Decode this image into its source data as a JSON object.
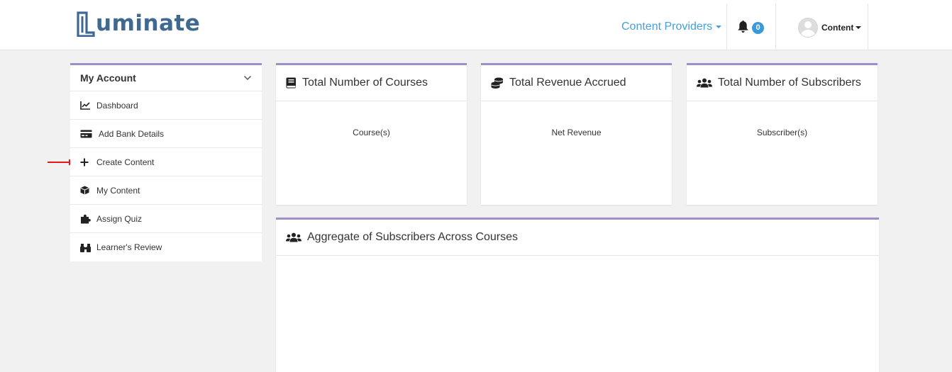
{
  "brand": {
    "logo_text": "uminate",
    "logo_color": "#3f6990"
  },
  "header": {
    "nav_label": "Content Providers",
    "notification_count": "0",
    "user_name": "Content",
    "accent_color": "#45a0e0"
  },
  "sidebar": {
    "title": "My Account",
    "items": [
      {
        "label": "Dashboard",
        "icon": "chart-line-icon"
      },
      {
        "label": "Add Bank Details",
        "icon": "credit-card-icon"
      },
      {
        "label": "Create Content",
        "icon": "plus-icon"
      },
      {
        "label": "My Content",
        "icon": "cube-icon"
      },
      {
        "label": "Assign Quiz",
        "icon": "puzzle-icon"
      },
      {
        "label": "Learner's Review",
        "icon": "binoculars-icon"
      }
    ]
  },
  "cards": [
    {
      "title": "Total Number of Courses",
      "body": "Course(s)",
      "icon": "book-icon"
    },
    {
      "title": "Total Revenue Accrued",
      "body": "Net Revenue",
      "icon": "coins-icon"
    },
    {
      "title": "Total Number of Subscribers",
      "body": "Subscriber(s)",
      "icon": "users-icon"
    }
  ],
  "aggregate": {
    "title": "Aggregate of Subscribers Across Courses",
    "icon": "users-icon"
  },
  "colors": {
    "panel_border": "#9e8fcb",
    "annotation_arrow": "#e8161b",
    "badge": "#3a9ad9"
  }
}
